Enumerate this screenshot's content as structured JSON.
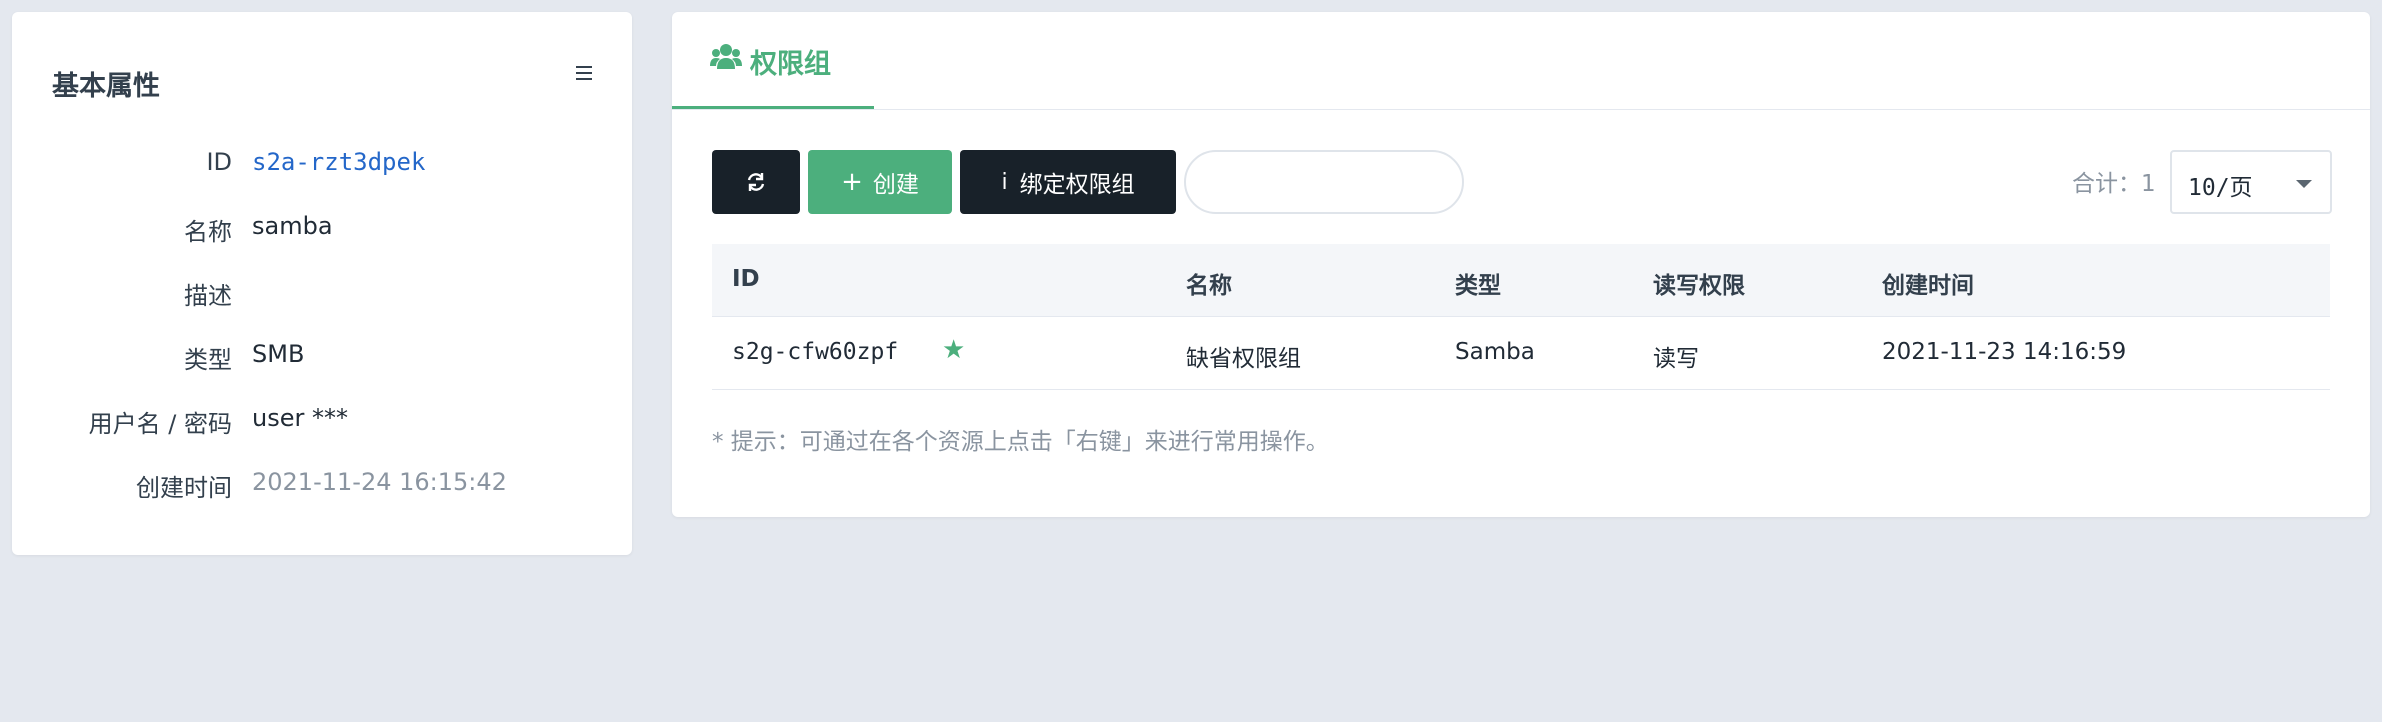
{
  "basic": {
    "title": "基本属性",
    "rows": [
      {
        "label": "ID",
        "value": "s2a-rzt3dpek"
      },
      {
        "label": "名称",
        "value": "samba"
      },
      {
        "label": "描述",
        "value": ""
      },
      {
        "label": "类型",
        "value": "SMB"
      },
      {
        "label": "用户名 / 密码",
        "value": "user ***"
      },
      {
        "label": "创建时间",
        "value": "2021-11-24 16:15:42"
      }
    ]
  },
  "tab": {
    "label": "权限组",
    "icon": "users-icon"
  },
  "toolbar": {
    "refresh_icon": "refresh-icon",
    "create_label": "创建",
    "bind_label": "绑定权限组",
    "search_value": "",
    "total": "合计：1",
    "page_size": "10/页"
  },
  "table": {
    "headers": [
      "ID",
      "名称",
      "类型",
      "读写权限",
      "创建时间"
    ],
    "rows": [
      {
        "id": "s2g-cfw60zpf",
        "name": "缺省权限组",
        "type": "Samba",
        "rw": "读写",
        "created": "2021-11-23 14:16:59",
        "default": true
      }
    ]
  },
  "hint": "* 提示：可通过在各个资源上点击「右键」来进行常用操作。",
  "colors": {
    "accent": "#4caf7d",
    "dark_button": "#182129",
    "link": "#2467c9",
    "background": "#e4e8ef"
  }
}
